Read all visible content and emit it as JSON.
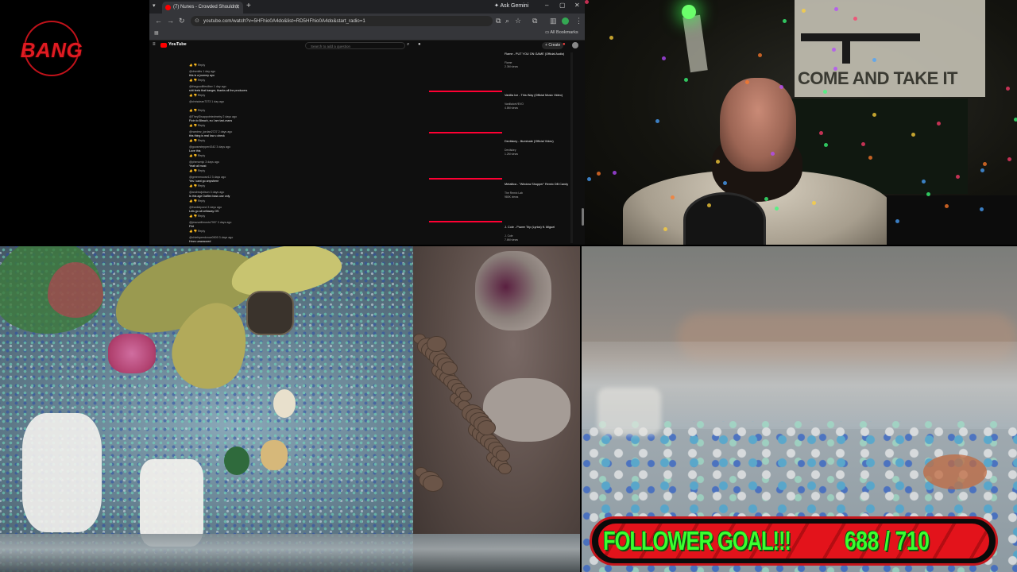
{
  "logo": {
    "text": "BANG"
  },
  "browser": {
    "tab_title": "(7) Nunes - Crowded Shouldn't",
    "ask_gemini": "Ask Gemini",
    "url": "youtube.com/watch?v=5HFhio0A4do&list=RD5HFhio0A4do&start_radio=1",
    "all_bookmarks": "All Bookmarks",
    "yt_logo": "YouTube",
    "search_placeholder": "Search to add a question",
    "create_label": "Create",
    "comments": [
      {
        "user": "",
        "text": "",
        "actions": "Reply"
      },
      {
        "user": "@drsmitts 1 day ago",
        "text": "this is a journey ayo",
        "actions": "Reply"
      },
      {
        "user": "@thegoodlifesilber 1 day ago",
        "text": "shit feels that banger, thanks all the producers",
        "actions": "Reply"
      },
      {
        "user": "@chrisdean7373 1 day ago",
        "text": "",
        "actions": "Reply"
      },
      {
        "user": "@TheyDisappointedmeby 2 days ago",
        "text": "Fixin to Bleach, eu I am taxi-mans",
        "actions": "Reply"
      },
      {
        "user": "@ramirez_jordan2727 2 days ago",
        "text": "this thing is real low u check",
        "actions": "Reply"
      },
      {
        "user": "@goosestepper4342 3 days ago",
        "text": "Love this",
        "actions": "Reply"
      },
      {
        "user": "@phenomjc 3 days ago",
        "text": "Yeah all most",
        "actions": "Reply"
      },
      {
        "user": "@greenmoose12 3 days ago",
        "text": "Yes I cant go anywhere",
        "actions": "Reply"
      },
      {
        "user": "@andrewjolison 3 days ago",
        "text": "Is this age Dalflex bass use only",
        "actions": "Reply"
      },
      {
        "user": "@frankiepond 3 days ago",
        "text": "Lets go all cellaway OS",
        "actions": "Reply"
      },
      {
        "user": "@jesuswillmusto7997 3 days ago",
        "text": "Flirt",
        "actions": "Reply"
      },
      {
        "user": "@chiefspeedcrow0909 3 days ago",
        "text": "Hmm unwrapped",
        "actions": "Reply"
      }
    ],
    "related": [
      {
        "title": "Flame - PUT YOU ON GAME (Official Audio)",
        "channel": "Flame",
        "views": "2.3M views"
      },
      {
        "title": "Vanilla Ice - This Way (Official Music Video)",
        "channel": "VanillaIceVEVO",
        "views": "4.8M views"
      },
      {
        "title": "Devilskey - Illuminate (Official Video)",
        "channel": "Devilskey",
        "views": "1.2M views"
      },
      {
        "title": "Metallica - \"Window Shopper\" Remix DB Candy",
        "channel": "The Remix Lab",
        "views": "980K views"
      },
      {
        "title": "J. Cole - Power Trip (Lyrics) ft. Miguel",
        "channel": "J. Cole",
        "views": "7.6M views"
      }
    ]
  },
  "webcam": {
    "poster_text": "COME AND TAKE IT"
  },
  "follower_goal": {
    "label": "FOLLOWER GOAL!!!",
    "count": "688 / 710",
    "current": 688,
    "target": 710
  }
}
